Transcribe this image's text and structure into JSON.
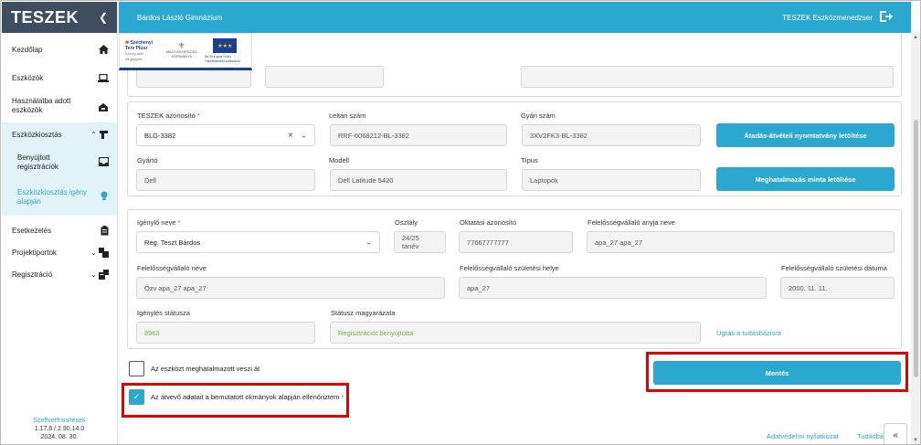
{
  "brand": {
    "name": "TESZEK",
    "collapse_icon": "chevron-left-icon"
  },
  "header": {
    "school": "Bárdos László Gimnázium",
    "app_name": "TESZEK Eszközmenedzser",
    "logout_icon": "logout-icon"
  },
  "sidebar": {
    "items": [
      {
        "label": "Kezdőlap",
        "icon": "home-icon"
      },
      {
        "label": "Eszközök",
        "icon": "laptop-icon"
      },
      {
        "label": "Használatba adott eszközök",
        "icon": "handover-icon"
      },
      {
        "label": "Eszközkiosztás",
        "icon": "distribution-icon",
        "expanded": true
      },
      {
        "label": "Benyújtott regisztrációk",
        "icon": "inbox-icon"
      },
      {
        "label": "Eszközkiosztás igény alapján",
        "icon": "bulb-icon"
      },
      {
        "label": "Esetkezelés",
        "icon": "clipboard-icon"
      },
      {
        "label": "Projektiportok",
        "icon": "portal-icon"
      },
      {
        "label": "Regisztráció",
        "icon": "registration-icon"
      }
    ],
    "footer": {
      "updates": "Szoftverfrissítések",
      "version": "1.17.6 / 2.90.14.0",
      "date": "2024. 08. 30."
    }
  },
  "logos": {
    "szechenyi": "Széchenyi Terv Plusz",
    "szechenyi_sub": "Szöveg alatti megjegyzés",
    "ministry": "MAGYARORSZÁG KORMÁNYA",
    "eu_text": "Az Európai Unió Társfinanszírozásával"
  },
  "device": {
    "id_label": "TESZEK azonosító",
    "id_value": "BLG-3382",
    "inventory_label": "Leltári szám",
    "inventory_value": "RRF-0068212-BL-3382",
    "serial_label": "Gyári szám",
    "serial_value": "3XV2FK3-BL-3382",
    "manufacturer_label": "Gyártó",
    "manufacturer_value": "Dell",
    "model_label": "Modell",
    "model_value": "Dell Latitude 5420",
    "type_label": "Típus",
    "type_value": "Laptopok",
    "download_handover_label": "Átadás-átvételi nyomtatvány letöltése",
    "download_authorization_label": "Meghatalmazás minta letöltése"
  },
  "request": {
    "applicant_label": "Igénylő neve",
    "applicant_value": "Reg. Teszt Bárdos",
    "class_label": "Osztály",
    "class_value": "24/25 tanév",
    "edu_id_label": "Oktatási azonosító",
    "edu_id_value": "77667777777",
    "guardian_mother_label": "Felelősségvállaló anyja neve",
    "guardian_mother_value": "apa_27 apa_27",
    "guardian_name_label": "Felelősségvállaló neve",
    "guardian_name_value": "Özv apa_27 apa_27",
    "guardian_birthplace_label": "Felelősségvállaló születési helye",
    "guardian_birthplace_value": "apa_27",
    "guardian_birthdate_label": "Felelősségvállaló születési dátuma",
    "guardian_birthdate_value": "2000. 11. 11.",
    "status_label": "Igénylés státusza",
    "status_value": "8963",
    "status_reason_label": "Státusz magyarázata",
    "status_reason_value": "Regisztrációt benyújtotta",
    "kb_link": "Ugrás a tudásbázisra"
  },
  "form": {
    "authorized_checkbox_label": "Az eszközt meghatalmazott veszi át",
    "verified_checkbox_label": "Az átvevő adatait a bemutatott okmányok alapján ellenőriztem",
    "save_label": "Mentés"
  },
  "footer_links": {
    "privacy": "Adatvédelmi nyilatkozat",
    "kb": "Tudásbá"
  }
}
